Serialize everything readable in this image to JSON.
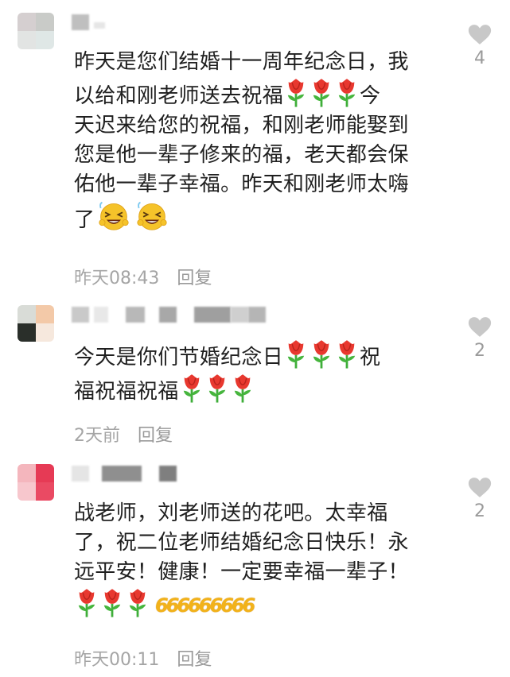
{
  "comments": [
    {
      "text_lines": [
        "昨天是您们结婚十一周年纪念日，我",
        "以给和刚老师送去祝福",
        "天迟来给您的祝福，和刚老师能娶到",
        "您是他一辈子修来的福，老天都会保",
        "佑他一辈子幸福。昨天和刚老师太嗨",
        "了"
      ],
      "text_tail_line2": "今",
      "time": "昨天08:43",
      "reply": "回复",
      "likes": "4"
    },
    {
      "text_lines": [
        "今天是你们节婚纪念日",
        "福祝福祝福"
      ],
      "text_tail_line1": "祝",
      "time": "2天前",
      "reply": "回复",
      "likes": "2"
    },
    {
      "text_lines": [
        "战老师，刘老师送的花吧。太幸福",
        "了，祝二位老师结婚纪念日快乐！永",
        "远平安！健康！一定要幸福一辈子！"
      ],
      "emoji_666": "666666666",
      "time": "昨天00:11",
      "reply": "回复",
      "likes": "2"
    }
  ],
  "icons": {
    "rose": "rose-emoji",
    "laugh": "laughing-face-emoji",
    "like": "heart-icon",
    "six": "666-emoji"
  },
  "colors": {
    "heart": "#c8c8c8",
    "meta_text": "#a5a5a5",
    "rose_red": "#e8382f",
    "rose_stem": "#3fae3a",
    "emoji_yellow": "#f5c32a"
  }
}
